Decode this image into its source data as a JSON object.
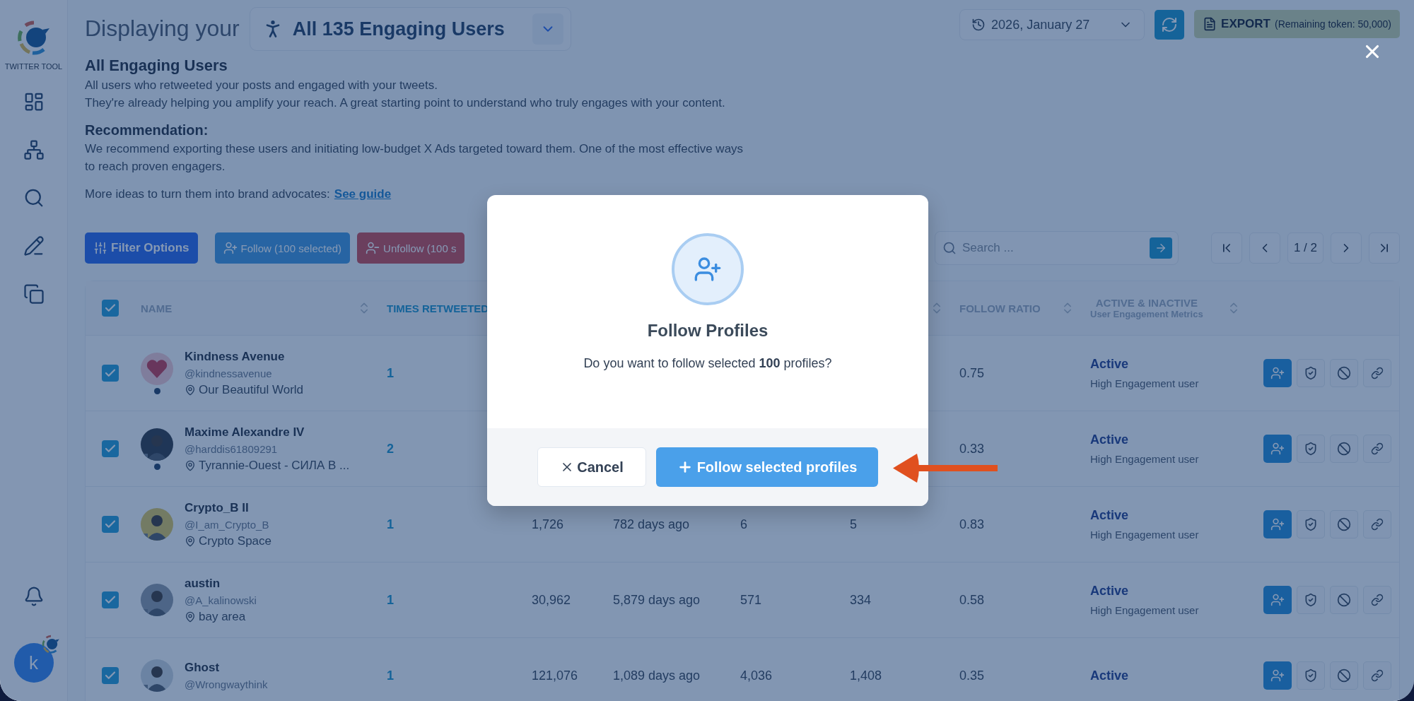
{
  "sidebar": {
    "brand": "TWITTER TOOL",
    "avatar": "k"
  },
  "header": {
    "prefix": "Displaying your",
    "segment": "All 135 Engaging Users",
    "date": "2026, January 27",
    "export": {
      "label": "EXPORT",
      "note": "(Remaining token: 50,000)"
    }
  },
  "intro": {
    "title": "All Engaging Users",
    "lines": [
      "All users who retweeted your posts and engaged with your tweets.",
      "They're already helping you amplify your reach. A great starting point to understand who truly engages with your content."
    ],
    "recommendation_title": "Recommendation:",
    "recommendation_lines": [
      "We recommend exporting these users and initiating low-budget X Ads targeted toward them. One of the most effective ways",
      "to reach proven engagers."
    ],
    "more": "More ideas to turn them into brand advocates:",
    "link": "See guide"
  },
  "toolbar": {
    "buttons": [
      {
        "kind": "filter",
        "label": "Filter Options"
      },
      {
        "kind": "follow",
        "label": "Follow (100 selected)"
      },
      {
        "kind": "unfollow",
        "label": "Unfollow (100 s"
      }
    ],
    "search": {
      "placeholder": "Search ..."
    },
    "page": "1 / 2"
  },
  "table": {
    "all_checked": true,
    "columns": [
      {
        "kind": "name",
        "label": "NAME",
        "sorted": false,
        "sortable": true
      },
      {
        "kind": "value",
        "label": "TIMES RETWEETED",
        "sorted": true
      },
      {
        "kind": "value"
      },
      {
        "kind": "value"
      },
      {
        "kind": "value"
      },
      {
        "kind": "value",
        "sortable": true
      },
      {
        "kind": "value",
        "label": "FOLLOW RATIO",
        "sorted": false,
        "sortable": true
      },
      {
        "kind": "status",
        "label": "ACTIVE & INACTIVE",
        "sublabel": "User Engagement Metrics",
        "sorted": false,
        "sortable": true
      }
    ],
    "rows": [
      {
        "checked": true,
        "name": "Kindness Avenue",
        "handle": "@kindnessavenue",
        "location": "Our Beautiful World",
        "dot": true,
        "times_retweeted": "1",
        "follow_ratio": "0.75",
        "status": "Active",
        "status_note": "High Engagement user"
      },
      {
        "checked": true,
        "name": "Maxime Alexandre IV",
        "handle": "@harddis61809291",
        "location": "Tyrannie-Ouest - СИЛА В ...",
        "dot": true,
        "times_retweeted": "2",
        "follow_ratio": "0.33",
        "status": "Active",
        "status_note": "High Engagement user"
      },
      {
        "checked": true,
        "name": "Crypto_B II",
        "handle": "@I_am_Crypto_B",
        "location": "Crypto Space",
        "dot": false,
        "times_retweeted": "1",
        "column_3": "1,726",
        "column_4": "782 days ago",
        "column_5": "6",
        "column_6": "5",
        "follow_ratio": "0.83",
        "status": "Active",
        "status_note": "High Engagement user"
      },
      {
        "checked": true,
        "name": "austin",
        "handle": "@A_kalinowski",
        "location": "bay area",
        "dot": false,
        "times_retweeted": "1",
        "column_3": "30,962",
        "column_4": "5,879 days ago",
        "column_5": "571",
        "column_6": "334",
        "follow_ratio": "0.58",
        "status": "Active",
        "status_note": "High Engagement user"
      },
      {
        "checked": true,
        "name": "Ghost",
        "handle": "@Wrongwaythink",
        "dot": false,
        "times_retweeted": "1",
        "column_3": "121,076",
        "column_4": "1,089 days ago",
        "column_5": "4,036",
        "column_6": "1,408",
        "follow_ratio": "0.35",
        "status": "Active"
      }
    ]
  },
  "modal": {
    "title": "Follow Profiles",
    "message": "Do you want to follow selected **100** profiles?",
    "cancel": "Cancel",
    "confirm": "Follow selected profiles"
  }
}
